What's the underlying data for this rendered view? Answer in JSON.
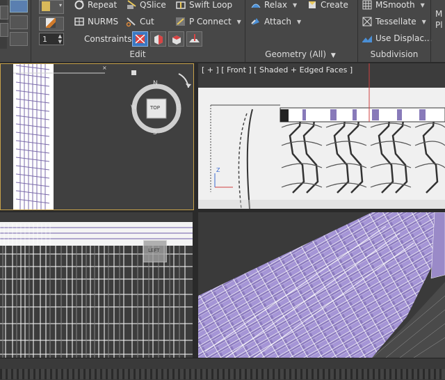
{
  "ribbon": {
    "edit_panel": {
      "repeat": "Repeat",
      "qslice": "QSlice",
      "swift_loop": "Swift Loop",
      "nurms": "NURMS",
      "cut": "Cut",
      "p_connect": "P Connect",
      "constraints": "Constraints:",
      "label": "Edit"
    },
    "geometry_panel": {
      "relax": "Relax",
      "create": "Create",
      "attach": "Attach",
      "label": "Geometry (All)"
    },
    "subdivision_panel": {
      "msmooth": "MSmooth",
      "tessellate": "Tessellate",
      "use_displace": "Use Displac...",
      "label": "Subdivision"
    },
    "partial_right": {
      "line1": "M",
      "line2": "Pl"
    },
    "spinner_value": "1"
  },
  "viewports": {
    "front": {
      "label": "[ + ] [ Front ] [ Shaded + Edged Faces ]"
    },
    "viewcube": {
      "top": "TOP",
      "n": "N",
      "s": "S",
      "e": "E",
      "w": "W"
    },
    "left_cube": "LEFT"
  },
  "colors": {
    "accent": "#c8a24a",
    "mesh": "#8c7bbf",
    "wire": "#ffffff"
  }
}
